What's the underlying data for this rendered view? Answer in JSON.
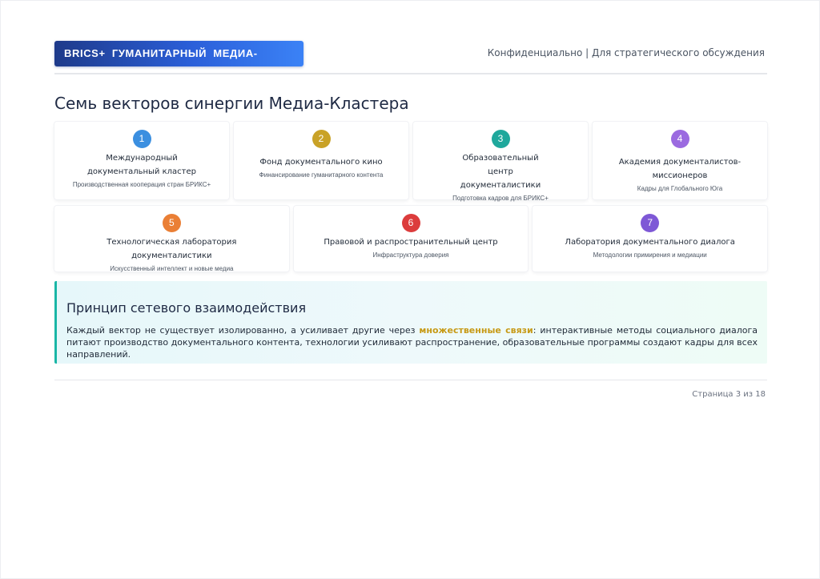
{
  "header": {
    "brand": "BRICS+ ГУМАНИТАРНЫЙ МЕДИА-КЛАСТЕР",
    "confidential": "Конфиденциально | Для стратегического обсуждения"
  },
  "title": "Семь векторов синергии Медиа-Кластера",
  "vectors": [
    {
      "num": "1",
      "title": "Международный документальный кластер",
      "sub": "Производственная кооперация стран БРИКС+",
      "color": "#3b8fe0"
    },
    {
      "num": "2",
      "title": "Фонд документального кино",
      "sub": "Финансирование гуманитарного контента",
      "color": "#c9a227"
    },
    {
      "num": "3",
      "title": "Образовательный центр документалистики",
      "sub": "Подготовка кадров для БРИКС+",
      "color": "#1fa89c"
    },
    {
      "num": "4",
      "title": "Академия документалистов-миссионеров",
      "sub": "Кадры для Глобального Юга",
      "color": "#9b6ae0"
    },
    {
      "num": "5",
      "title": "Технологическая лаборатория документалистики",
      "sub": "Искусственный интеллект и новые медиа",
      "color": "#ea7f35"
    },
    {
      "num": "6",
      "title": "Правовой и распространительный центр",
      "sub": "Инфраструктура доверия",
      "color": "#dc3c3c"
    },
    {
      "num": "7",
      "title": "Лаборатория документального диалога",
      "sub": "Методологии примирения и медиации",
      "color": "#7e58d6"
    }
  ],
  "principle": {
    "title": "Принцип сетевого взаимодействия",
    "text_before": "Каждый вектор не существует изолированно, а усиливает другие через ",
    "highlight": "множественные связи",
    "text_after": ": интерактивные методы социального диалога питают производство документального контента, технологии усиливают распространение, образовательные программы создают кадры для всех направлений.",
    "accent_color": "#19b6a6",
    "highlight_color": "#c79a16"
  },
  "footer": {
    "page": "Страница 3 из 18"
  }
}
